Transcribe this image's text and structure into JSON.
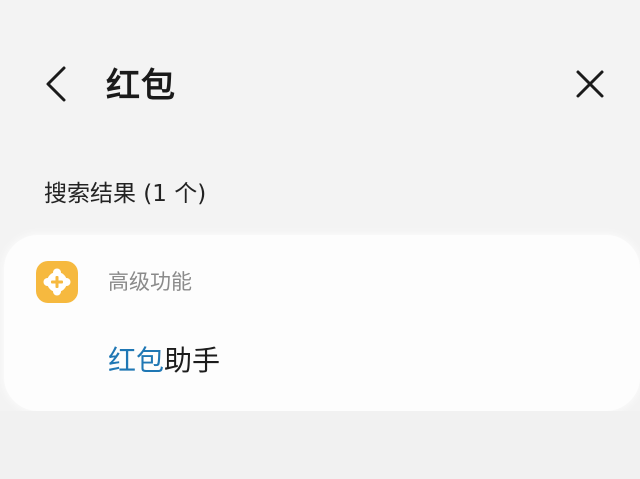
{
  "header": {
    "query": "红包",
    "back_icon": "chevron-left-icon",
    "close_icon": "close-icon"
  },
  "results": {
    "heading": "搜索结果 (1 个)",
    "category": {
      "label": "高级功能",
      "icon": "gear-plus-icon",
      "icon_color": "#f6b93f"
    },
    "item": {
      "highlight": "红包",
      "rest": "助手",
      "highlight_color": "#1f77b4"
    }
  }
}
